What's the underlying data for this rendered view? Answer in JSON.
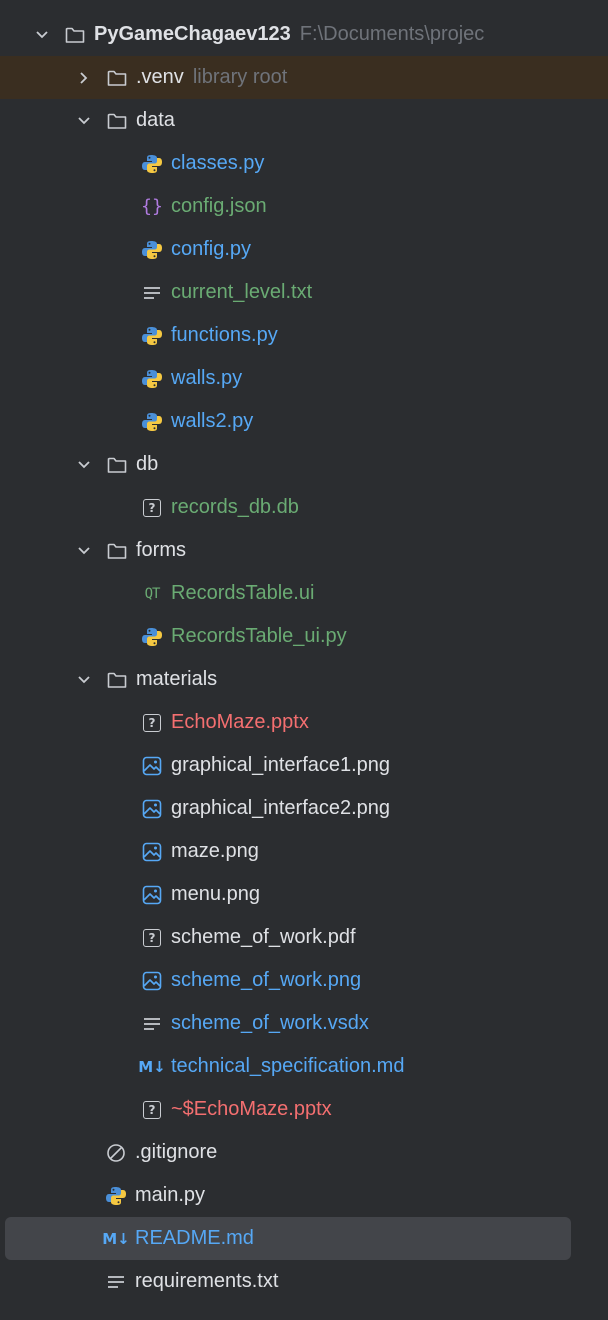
{
  "root": {
    "label": "PyGameChagaev123",
    "path": "F:\\Documents\\projec"
  },
  "venv": {
    "label": ".venv",
    "hint": "library root"
  },
  "folders": {
    "data": "data",
    "db": "db",
    "forms": "forms",
    "materials": "materials"
  },
  "data_files": [
    "classes.py",
    "config.json",
    "config.py",
    "current_level.txt",
    "functions.py",
    "walls.py",
    "walls2.py"
  ],
  "db_files": [
    "records_db.db"
  ],
  "forms_files": [
    "RecordsTable.ui",
    "RecordsTable_ui.py"
  ],
  "materials_files": [
    "EchoMaze.pptx",
    "graphical_interface1.png",
    "graphical_interface2.png",
    "maze.png",
    "menu.png",
    "scheme_of_work.pdf",
    "scheme_of_work.png",
    "scheme_of_work.vsdx",
    "technical_specification.md",
    "~$EchoMaze.pptx"
  ],
  "root_files": [
    ".gitignore",
    "main.py",
    "README.md",
    "requirements.txt"
  ],
  "colors": {
    "background": "#2b2d30",
    "text": "#dfe1e5",
    "hint": "#6f737a",
    "green": "#6aab73",
    "blue": "#56a8f5",
    "red": "#f46f70",
    "selection": "#43454a",
    "excluded": "#3a2e20"
  }
}
